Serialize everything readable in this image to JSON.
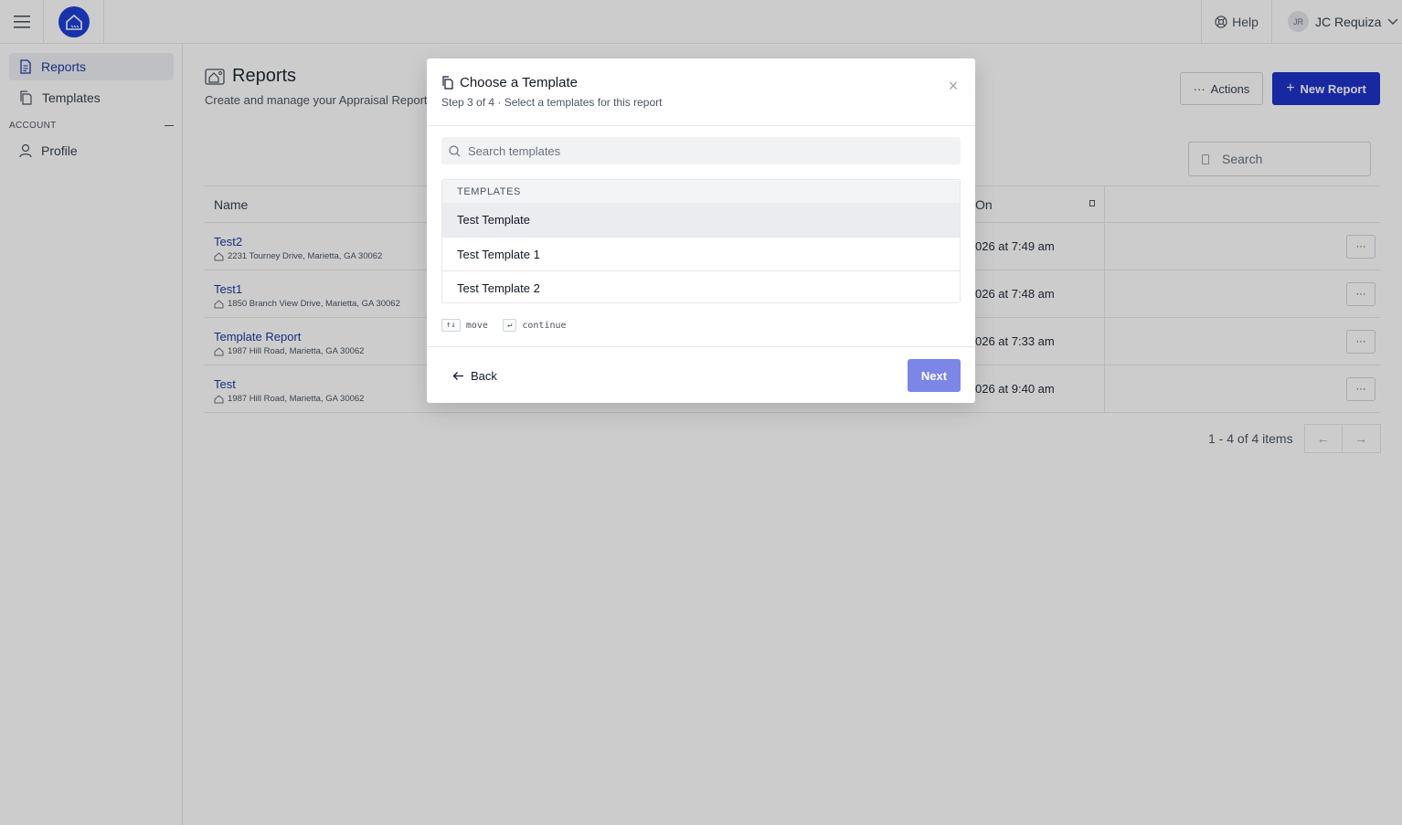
{
  "topbar": {
    "help_label": "Help",
    "user_initials": "JR",
    "user_name": "JC Requiza"
  },
  "sidebar": {
    "items": [
      {
        "label": "Reports",
        "icon": "document-icon"
      },
      {
        "label": "Templates",
        "icon": "copy-icon"
      }
    ],
    "section_label": "ACCOUNT",
    "account_items": [
      {
        "label": "Profile",
        "icon": "user-icon"
      }
    ]
  },
  "page": {
    "title": "Reports",
    "subtitle": "Create and manage your Appraisal Reports",
    "actions_label": "Actions",
    "new_report_label": "New Report",
    "search_placeholder": "Search"
  },
  "table": {
    "columns": [
      "Name",
      "On"
    ],
    "rows": [
      {
        "name": "Test2",
        "address": "2231 Tourney Drive, Marietta, GA 30062",
        "date": "026 at 7:49 am"
      },
      {
        "name": "Test1",
        "address": "1850 Branch View Drive, Marietta, GA 30062",
        "date": "026 at 7:48 am"
      },
      {
        "name": "Template Report",
        "address": "1987 Hill Road, Marietta, GA 30062",
        "date": "026 at 7:33 am"
      },
      {
        "name": "Test",
        "address": "1987 Hill Road, Marietta, GA 30062",
        "date": "026 at 9:40 am"
      }
    ],
    "pagination": "1 - 4 of 4 items"
  },
  "modal": {
    "title": "Choose a Template",
    "subtitle": "Step 3 of 4 · Select a templates for this report",
    "search_placeholder": "Search templates",
    "list_header": "TEMPLATES",
    "templates": [
      "Test Template",
      "Test Template 1",
      "Test Template 2"
    ],
    "hint_move_key": "↑↓",
    "hint_move": "move",
    "hint_continue_key": "↵",
    "hint_continue": "continue",
    "back_label": "Back",
    "next_label": "Next"
  },
  "colors": {
    "brand": "#1d32c8",
    "link": "#1e3a9e",
    "next_disabled": "#7b86e6"
  }
}
